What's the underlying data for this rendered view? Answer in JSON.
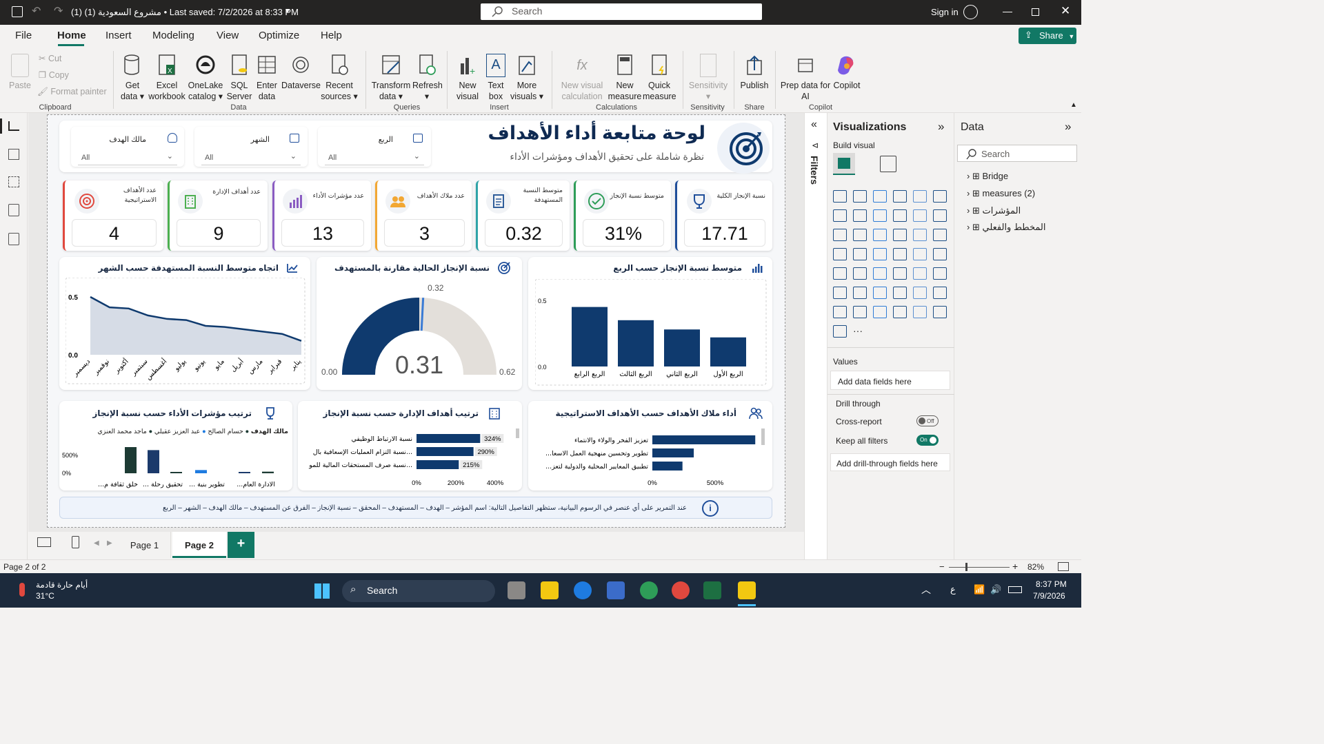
{
  "titlebar": {
    "title": "مشروع السعودية (1) (1) • Last saved: 7/2/2026 at 8:33 PM",
    "search_placeholder": "Search",
    "sign_in": "Sign in"
  },
  "menu": {
    "items": [
      "File",
      "Home",
      "Insert",
      "Modeling",
      "View",
      "Optimize",
      "Help"
    ],
    "share": "Share"
  },
  "ribbon": {
    "clipboard": {
      "paste": "Paste",
      "cut": "Cut",
      "copy": "Copy",
      "format_painter": "Format painter",
      "group": "Clipboard"
    },
    "data": {
      "get_data": "Get data",
      "excel": "Excel workbook",
      "onelake": "OneLake catalog",
      "sql": "SQL Server",
      "enter": "Enter data",
      "dataverse": "Dataverse",
      "recent": "Recent sources",
      "group": "Data"
    },
    "queries": {
      "transform": "Transform data",
      "refresh": "Refresh",
      "group": "Queries"
    },
    "insert": {
      "new_visual": "New visual",
      "text_box": "Text box",
      "more_visuals": "More visuals",
      "group": "Insert"
    },
    "calculations": {
      "new_visual_calc": "New visual calculation",
      "new_measure": "New measure",
      "quick_measure": "Quick measure",
      "group": "Calculations"
    },
    "sensitivity": {
      "label": "Sensitivity",
      "group": "Sensitivity"
    },
    "share": {
      "publish": "Publish",
      "group": "Share"
    },
    "copilot": {
      "prep": "Prep data for AI",
      "copilot": "Copilot",
      "group": "Copilot"
    }
  },
  "report": {
    "title": "لوحة متابعة أداء الأهداف",
    "subtitle": "نظرة شاملة على تحقيق الأهداف ومؤشرات الأداء",
    "slicers": [
      {
        "label": "الربع",
        "value": "All"
      },
      {
        "label": "الشهر",
        "value": "All"
      },
      {
        "label": "مالك الهدف",
        "value": "All"
      }
    ],
    "kpis": [
      {
        "label": "نسبة الإنجاز الكلية",
        "value": "17.71",
        "color": "#1f4e9a"
      },
      {
        "label": "متوسط نسبة الإنجاز",
        "value": "31%",
        "color": "#2e9d58"
      },
      {
        "label": "متوسط النسبة المستهدفة",
        "value": "0.32",
        "color": "#2fa3a8"
      },
      {
        "label": "عدد ملاك الأهداف",
        "value": "3",
        "color": "#f2a733"
      },
      {
        "label": "عدد مؤشرات الأداء",
        "value": "13",
        "color": "#8a5cc2"
      },
      {
        "label": "عدد أهداف الإدارة",
        "value": "9",
        "color": "#4caf50"
      },
      {
        "label": "عدد الأهداف الاستراتيجية",
        "value": "4",
        "color": "#e0483e"
      }
    ],
    "line_title": "اتجاه متوسط النسبة المستهدفة حسب الشهر",
    "gauge_title": "نسبة الإنجاز الحالية مقارنة بالمستهدف",
    "bar_title": "متوسط نسبة الإنجاز حسب الربع",
    "kpi_rank_title": "ترتيب مؤشرات الأداء حسب نسبة الإنجاز",
    "mgmt_rank_title": "ترتيب أهداف الإدارة حسب نسبة الإنجاز",
    "owner_title": "أداء ملاك الأهداف حسب الأهداف الاستراتيجية",
    "footer_note": "عند التمرير على أي عنصر في الرسوم البيانية، ستظهر التفاصيل التالية: اسم المؤشر – الهدف – المستهدف – المحقق – نسبة الإنجاز – الفرق عن المستهدف – مالك الهدف – الشهر – الربع"
  },
  "chart_data": [
    {
      "type": "line",
      "title": "اتجاه متوسط النسبة المستهدفة حسب الشهر",
      "x": [
        "يناير",
        "فبراير",
        "مارس",
        "أبريل",
        "مايو",
        "يونيو",
        "يوليو",
        "أغسطس",
        "سبتمبر",
        "أكتوبر",
        "نوفمبر",
        "ديسمبر"
      ],
      "values": [
        0.12,
        0.18,
        0.2,
        0.22,
        0.24,
        0.25,
        0.3,
        0.31,
        0.34,
        0.4,
        0.41,
        0.5
      ],
      "yticks": [
        "0.5",
        "0.0"
      ],
      "ylim": [
        0,
        0.5
      ],
      "x_order": "right-to-left"
    },
    {
      "type": "gauge",
      "title": "نسبة الإنجاز الحالية مقارنة بالمستهدف",
      "value": 0.31,
      "value_label": "0.31",
      "target": 0.32,
      "target_label": "0.32",
      "min": 0,
      "min_label": "0.00",
      "max": 0.62,
      "max_label": "0.62"
    },
    {
      "type": "bar",
      "title": "متوسط نسبة الإنجاز حسب الربع",
      "categories": [
        "الربع الرابع",
        "الربع الثالث",
        "الربع الثاني",
        "الربع الأول"
      ],
      "values": [
        0.45,
        0.35,
        0.28,
        0.22
      ],
      "yticks": [
        "0.5",
        "0.0"
      ],
      "ylim": [
        0,
        0.5
      ]
    },
    {
      "type": "bar",
      "title": "ترتيب مؤشرات الأداء حسب نسبة الإنجاز",
      "legend_title": "مالك الهدف",
      "series": [
        {
          "name": "ماجد محمد العنزي",
          "color": "#1d3b34"
        },
        {
          "name": "عبد العزيز عقيلي",
          "color": "#1e7be0"
        },
        {
          "name": "حسام الصالح",
          "color": "#1d3b34"
        }
      ],
      "categories": [
        "خلق ثقافة م...",
        "تحقيق رحلة ...",
        "تطوير بنية ...",
        "الادارة العام..."
      ],
      "values": [
        1300,
        1150,
        50,
        160,
        40,
        80
      ],
      "colors": [
        "#1d3b34",
        "#1b3a6b",
        "#1d3b34",
        "#1e7be0",
        "#1b3a6b",
        "#1d3b34"
      ],
      "yticks": [
        "500%",
        "0%"
      ]
    },
    {
      "type": "bar",
      "title": "ترتيب أهداف الإدارة حسب نسبة الإنجاز",
      "orientation": "horizontal",
      "categories": [
        "نسبة الارتباط الوظيفي",
        "نسبة التزام العمليات الإسعافية بال...",
        "نسبة صرف المستحقات المالية للمو..."
      ],
      "values": [
        324,
        290,
        215
      ],
      "labels": [
        "324%",
        "290%",
        "215%"
      ],
      "xticks": [
        "0%",
        "200%",
        "400%"
      ]
    },
    {
      "type": "bar",
      "title": "أداء ملاك الأهداف حسب الأهداف الاستراتيجية",
      "orientation": "horizontal",
      "categories": [
        "تعزيز الفخر والولاء والانتماء",
        "...تطوير وتحسين منهجية العمل الاسعا",
        "...تطبيق المعايير المحلية والدولية لتعز"
      ],
      "values": [
        820,
        330,
        240
      ],
      "xticks": [
        "0%",
        "500%"
      ]
    }
  ],
  "panes": {
    "filters": "Filters",
    "visualizations": "Visualizations",
    "build_visual": "Build visual",
    "values": "Values",
    "add_data_fields": "Add data fields here",
    "drill_through": "Drill through",
    "cross_report": "Cross-report",
    "cross_report_state": "Off",
    "keep_all_filters": "Keep all filters",
    "keep_all_state": "On",
    "add_drill_fields": "Add drill-through fields here",
    "data": "Data",
    "data_search": "Search",
    "tables": [
      "Bridge",
      "measures (2)",
      "المؤشرات",
      "المخطط والفعلي"
    ]
  },
  "pages": {
    "tabs": [
      "Page 1",
      "Page 2"
    ],
    "active": "Page 2",
    "add": "+"
  },
  "status": {
    "page": "Page 2 of 2",
    "zoom": "82%"
  },
  "taskbar": {
    "weather": "أيام حارة قادمة",
    "temp": "31°C",
    "search": "Search",
    "time": "8:37 PM",
    "date": "7/9/2026",
    "lang": "ع"
  },
  "colors": {
    "accent": "#117865",
    "navy": "#0f3a6e",
    "gauge_rest": "#e3dfda"
  }
}
